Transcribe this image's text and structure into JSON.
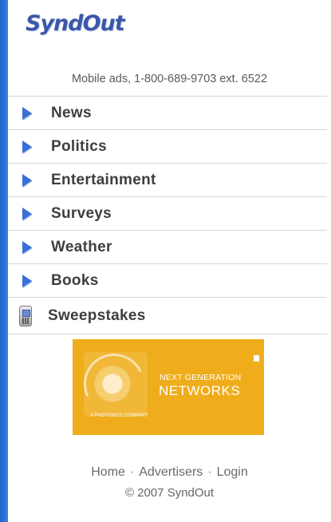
{
  "brand": {
    "logo_text": "SyndOut"
  },
  "tagline": "Mobile ads, 1-800-689-9703 ext. 6522",
  "menu": {
    "items": [
      {
        "label": "News",
        "icon": "arrow-icon"
      },
      {
        "label": "Politics",
        "icon": "arrow-icon"
      },
      {
        "label": "Entertainment",
        "icon": "arrow-icon"
      },
      {
        "label": "Surveys",
        "icon": "arrow-icon"
      },
      {
        "label": "Weather",
        "icon": "arrow-icon"
      },
      {
        "label": "Books",
        "icon": "arrow-icon"
      },
      {
        "label": "Sweepstakes",
        "icon": "phone-icon"
      }
    ]
  },
  "banner": {
    "line1": "NEXT GENERATION",
    "line2": "NETWORKS",
    "small_text": "A PHOTONICS COMPANY",
    "background_color": "#efad1b"
  },
  "footer": {
    "links": [
      "Home",
      "Advertisers",
      "Login"
    ],
    "separator": "·",
    "copyright": "© 2007 SyndOut"
  },
  "colors": {
    "logo": "#3a57a9",
    "arrow": "#3a6fd6",
    "menu_text": "#3e3e3e",
    "left_strip": "#2a74d6"
  }
}
